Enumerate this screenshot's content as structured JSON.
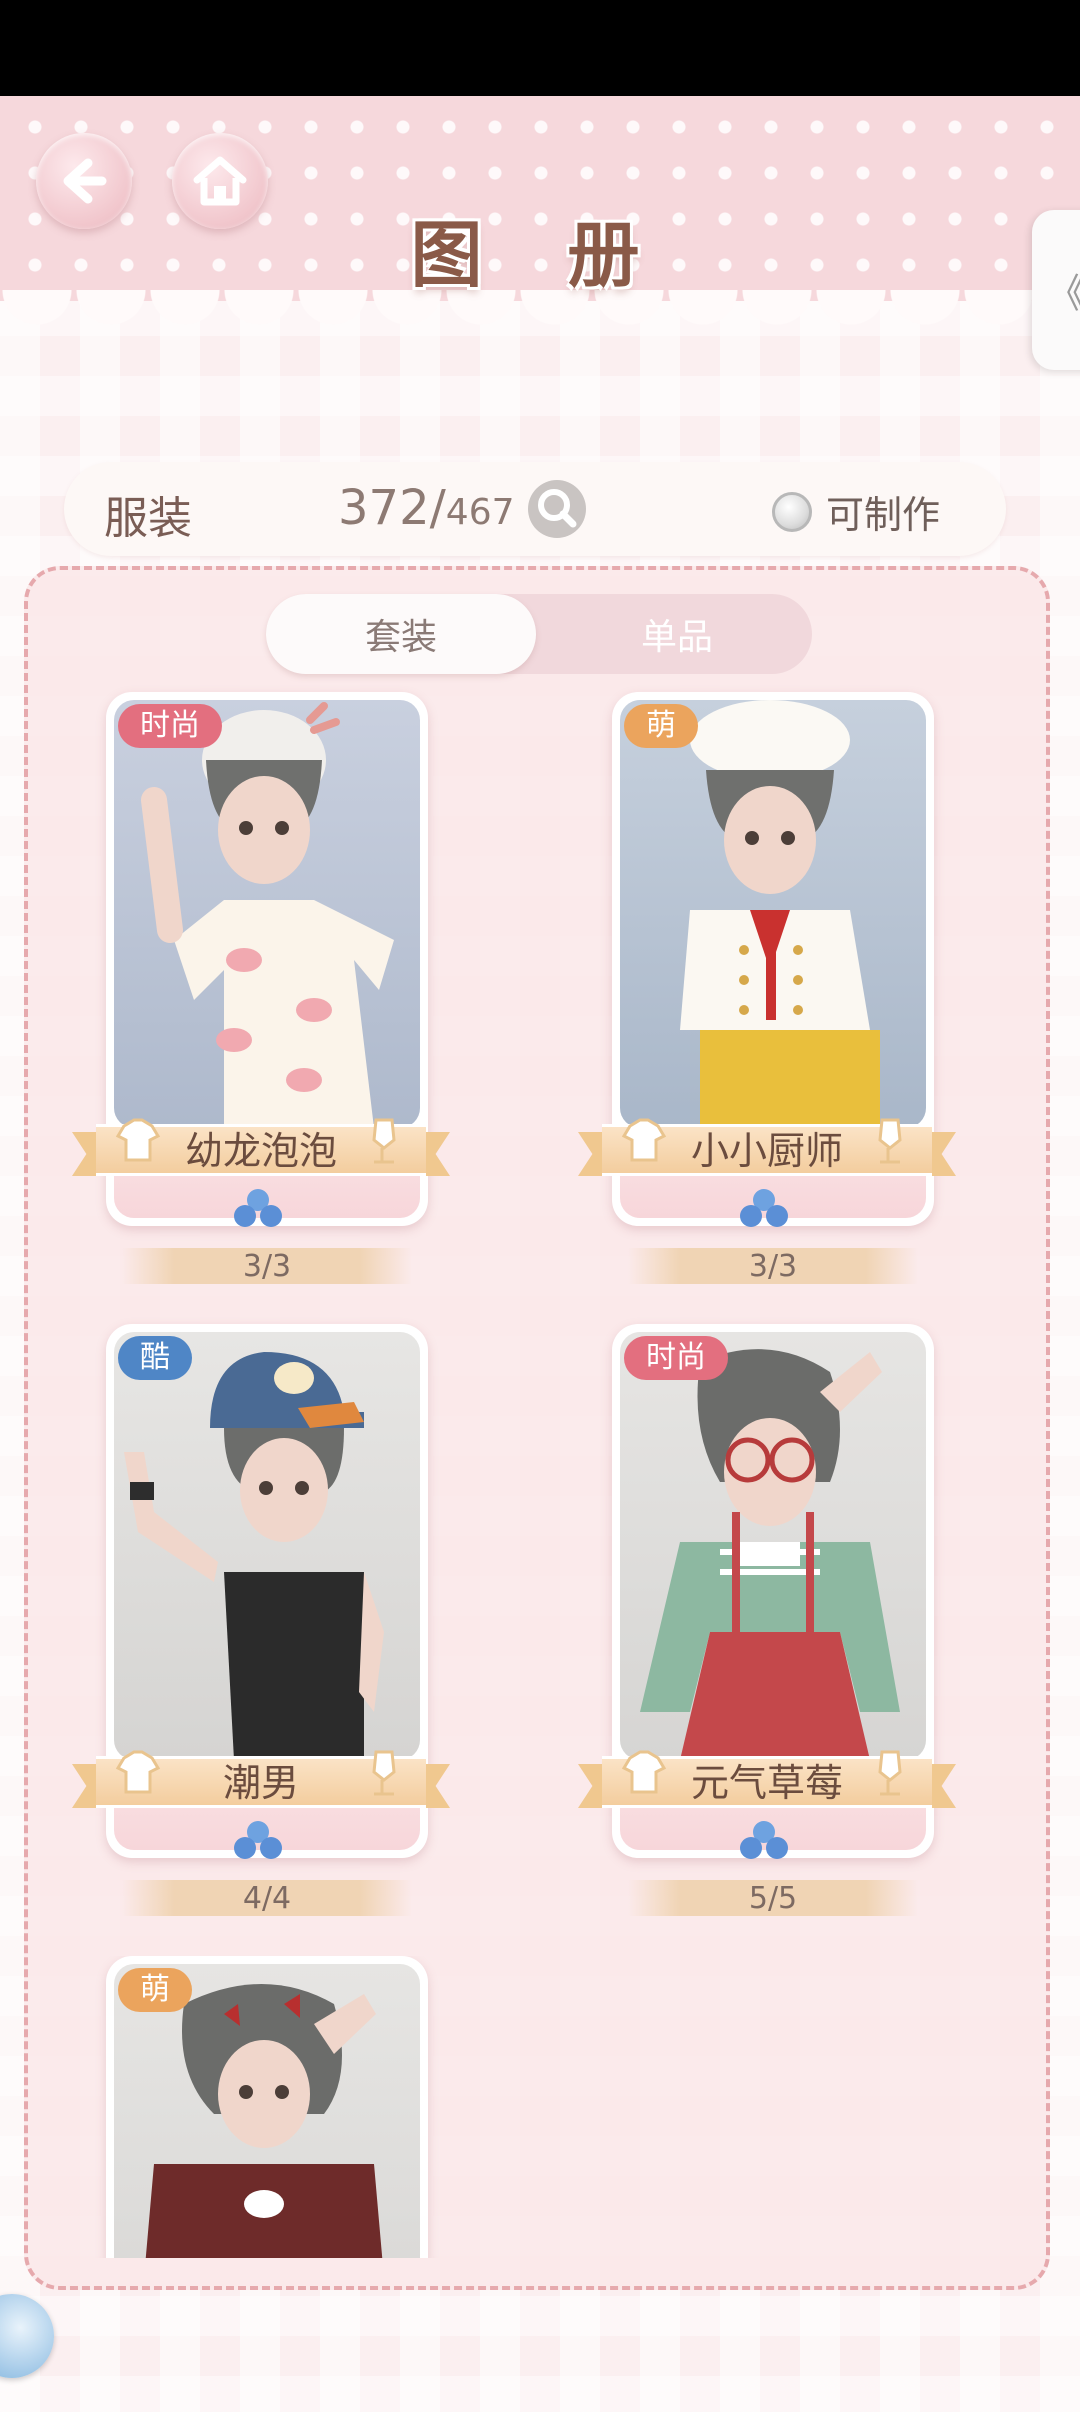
{
  "header": {
    "title": "图 册",
    "back_icon": "arrow-left-icon",
    "home_icon": "home-icon",
    "side_tab_glyph": "《"
  },
  "summary": {
    "category": "服装",
    "collected": "372",
    "slash": "/",
    "total": "467",
    "search_icon": "magnifier-icon",
    "craftable_label": "可制作"
  },
  "tabs": [
    {
      "label": "套装",
      "active": true
    },
    {
      "label": "单品",
      "active": false
    }
  ],
  "outfits": [
    {
      "tag": "时尚",
      "tag_color": "#e36f7f",
      "name": "幼龙泡泡",
      "progress": "3/3"
    },
    {
      "tag": "萌",
      "tag_color": "#eba45d",
      "name": "小小厨师",
      "progress": "3/3"
    },
    {
      "tag": "酷",
      "tag_color": "#4f86c6",
      "name": "潮男",
      "progress": "4/4"
    },
    {
      "tag": "时尚",
      "tag_color": "#e36f7f",
      "name": "元气草莓",
      "progress": "5/5"
    },
    {
      "tag": "萌",
      "tag_color": "#eba45d",
      "name": "",
      "progress": ""
    }
  ]
}
